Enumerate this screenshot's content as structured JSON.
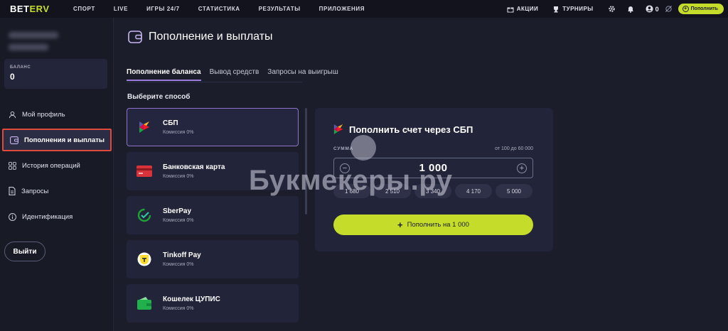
{
  "header": {
    "logo_main": "BET",
    "logo_accent": "ERV",
    "nav": [
      "СПОРТ",
      "LIVE",
      "ИГРЫ 24/7",
      "СТАТИСТИКА",
      "РЕЗУЛЬТАТЫ",
      "ПРИЛОЖЕНИЯ"
    ],
    "promotions": "АКЦИИ",
    "tournaments": "ТУРНИРЫ",
    "balance": "0",
    "deposit_label": "Пополнить"
  },
  "sidebar": {
    "balance_label": "БАЛАНС",
    "balance_value": "0",
    "items": [
      {
        "label": "Мой профиль",
        "icon": "user-icon"
      },
      {
        "label": "Пополнения и выплаты",
        "icon": "wallet-icon"
      },
      {
        "label": "История операций",
        "icon": "grid-icon"
      },
      {
        "label": "Запросы",
        "icon": "document-icon"
      },
      {
        "label": "Идентификация",
        "icon": "info-icon"
      }
    ],
    "logout": "Выйти"
  },
  "main": {
    "title": "Пополнение и выплаты",
    "tabs": [
      "Пополнение баланса",
      "Вывод средств",
      "Запросы на выигрыш"
    ],
    "choose_label": "Выберите способ",
    "methods": [
      {
        "name": "СБП",
        "fee": "Комиссия 0%",
        "icon": "sbp-icon"
      },
      {
        "name": "Банковская карта",
        "fee": "Комиссия 0%",
        "icon": "bank-card-icon"
      },
      {
        "name": "SberPay",
        "fee": "Комиссия 0%",
        "icon": "sberpay-icon"
      },
      {
        "name": "Tinkoff Pay",
        "fee": "Комиссия 0%",
        "icon": "tinkoff-icon"
      },
      {
        "name": "Кошелек ЦУПИС",
        "fee": "Комиссия 0%",
        "icon": "cupis-wallet-icon"
      }
    ]
  },
  "deposit": {
    "title": "Пополнить счет через СБП",
    "sum_label": "СУММА",
    "range": "от 100 до 60 000",
    "amount": "1 000",
    "chips": [
      "1 680",
      "2 510",
      "3 340",
      "4 170",
      "5 000"
    ],
    "button": "Пополнить на 1 000"
  },
  "watermark": "Букмекеры.ру",
  "colors": {
    "accent": "#c5dc2a",
    "highlight_border": "#e04a3d",
    "active_tab": "#9b7bd9"
  }
}
